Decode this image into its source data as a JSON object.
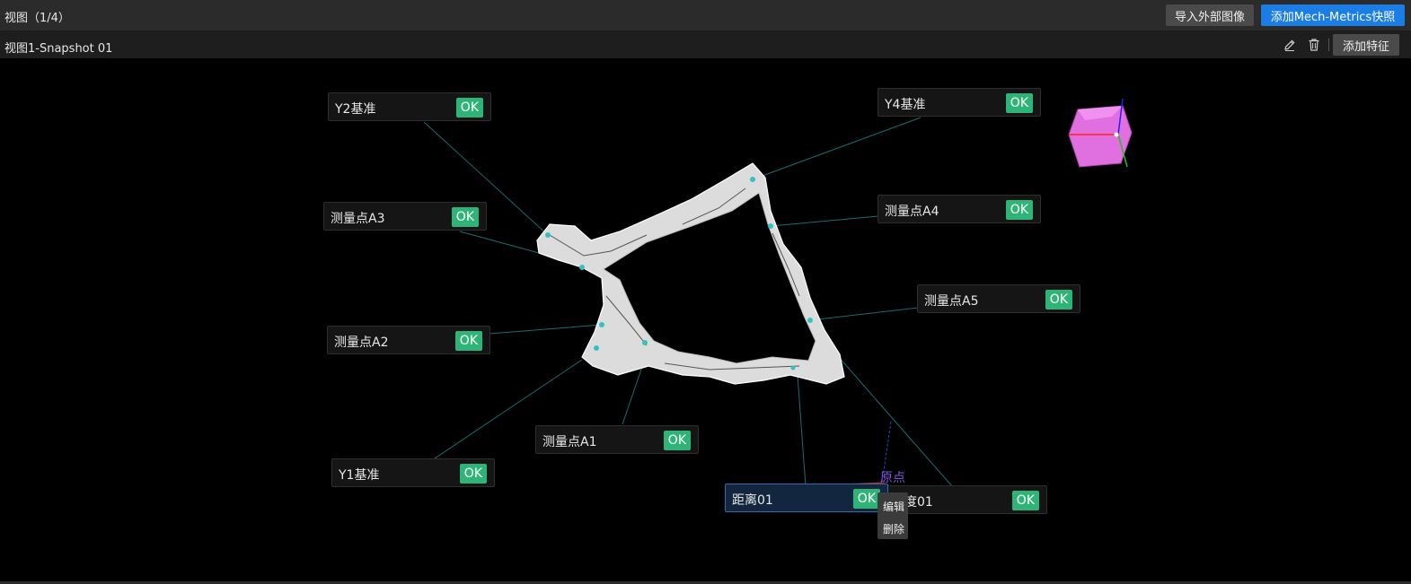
{
  "header": {
    "title": "视图（1/4）",
    "import_button": "导入外部图像",
    "add_snapshot_button": "添加Mech-Metrics快照"
  },
  "subheader": {
    "title": "视图1-Snapshot 01",
    "add_feature_button": "添加特征"
  },
  "icons": {
    "edit": "pencil-icon",
    "delete": "trash-icon"
  },
  "features": [
    {
      "label": "Y2基准",
      "status": "OK"
    },
    {
      "label": "Y4基准",
      "status": "OK"
    },
    {
      "label": "测量点A3",
      "status": "OK"
    },
    {
      "label": "测量点A4",
      "status": "OK"
    },
    {
      "label": "测量点A5",
      "status": "OK"
    },
    {
      "label": "测量点A2",
      "status": "OK"
    },
    {
      "label": "测量点A1",
      "status": "OK"
    },
    {
      "label": "Y1基准",
      "status": "OK"
    },
    {
      "label": "距离01",
      "status": "OK"
    },
    {
      "label": "度01",
      "status": "OK"
    }
  ],
  "context_menu": {
    "edit": "编辑",
    "delete": "删除"
  },
  "origin_label": "原点",
  "colors": {
    "ok_green": "#2fb478",
    "accent_blue": "#1a7ee6",
    "leader_line": "#1e6b6b",
    "cube": "#e070e0"
  }
}
